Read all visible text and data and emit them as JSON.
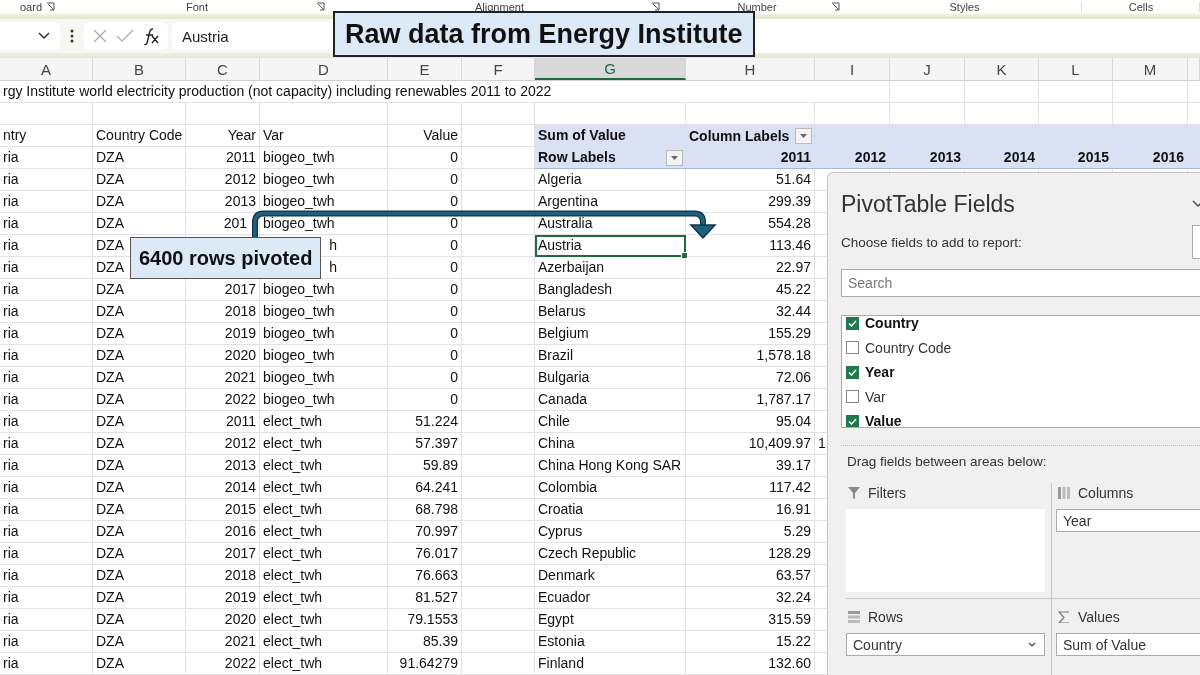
{
  "ribbon_groups": [
    {
      "label": "oard",
      "launcher": true
    },
    {
      "label": "Font",
      "launcher": true
    },
    {
      "label": "Alignment",
      "launcher": true
    },
    {
      "label": "Number",
      "launcher": true
    },
    {
      "label": "Styles",
      "launcher": false
    },
    {
      "label": "Cells",
      "launcher": false
    }
  ],
  "formula_bar": {
    "value": "Austria"
  },
  "callouts": [
    {
      "text": "Raw data from Energy Institute",
      "kind": "title"
    },
    {
      "text": "6400 rows pivoted",
      "kind": "note"
    }
  ],
  "columns": [
    {
      "label": "A",
      "selected": false
    },
    {
      "label": "B",
      "selected": false
    },
    {
      "label": "C",
      "selected": false
    },
    {
      "label": "D",
      "selected": false
    },
    {
      "label": "E",
      "selected": false
    },
    {
      "label": "F",
      "selected": false
    },
    {
      "label": "G",
      "selected": true
    },
    {
      "label": "H",
      "selected": false
    },
    {
      "label": "I",
      "selected": false
    },
    {
      "label": "J",
      "selected": false
    },
    {
      "label": "K",
      "selected": false
    },
    {
      "label": "L",
      "selected": false
    },
    {
      "label": "M",
      "selected": false
    }
  ],
  "sheet_title": "rgy Institute world electricity production (not capacity) including renewables 2011 to 2022",
  "raw_data": {
    "columns": [
      {
        "label": "ntry",
        "kind": "text"
      },
      {
        "label": "Country Code",
        "kind": "text"
      },
      {
        "label": "Year",
        "kind": "number"
      },
      {
        "label": "Var",
        "kind": "text"
      },
      {
        "label": "Value",
        "kind": "number"
      }
    ],
    "rows": [
      [
        "ria",
        "DZA",
        "2011",
        "biogeo_twh",
        "0"
      ],
      [
        "ria",
        "DZA",
        "2012",
        "biogeo_twh",
        "0"
      ],
      [
        "ria",
        "DZA",
        "2013",
        "biogeo_twh",
        "0"
      ],
      [
        "ria",
        "DZA",
        {
          "text": "201",
          "covered": true
        },
        "biogeo_twh",
        "0"
      ],
      [
        "ria",
        "DZA",
        null,
        {
          "text": "h",
          "covered": true
        },
        "0"
      ],
      [
        "ria",
        "DZA",
        null,
        {
          "text": "h",
          "covered": true
        },
        "0"
      ],
      [
        "ria",
        "DZA",
        "2017",
        "biogeo_twh",
        "0"
      ],
      [
        "ria",
        "DZA",
        "2018",
        "biogeo_twh",
        "0"
      ],
      [
        "ria",
        "DZA",
        "2019",
        "biogeo_twh",
        "0"
      ],
      [
        "ria",
        "DZA",
        "2020",
        "biogeo_twh",
        "0"
      ],
      [
        "ria",
        "DZA",
        "2021",
        "biogeo_twh",
        "0"
      ],
      [
        "ria",
        "DZA",
        "2022",
        "biogeo_twh",
        "0"
      ],
      [
        "ria",
        "DZA",
        "2011",
        "elect_twh",
        "51.224"
      ],
      [
        "ria",
        "DZA",
        "2012",
        "elect_twh",
        "57.397"
      ],
      [
        "ria",
        "DZA",
        "2013",
        "elect_twh",
        "59.89"
      ],
      [
        "ria",
        "DZA",
        "2014",
        "elect_twh",
        "64.241"
      ],
      [
        "ria",
        "DZA",
        "2015",
        "elect_twh",
        "68.798"
      ],
      [
        "ria",
        "DZA",
        "2016",
        "elect_twh",
        "70.997"
      ],
      [
        "ria",
        "DZA",
        "2017",
        "elect_twh",
        "76.017"
      ],
      [
        "ria",
        "DZA",
        "2018",
        "elect_twh",
        "76.663"
      ],
      [
        "ria",
        "DZA",
        "2019",
        "elect_twh",
        "81.527"
      ],
      [
        "ria",
        "DZA",
        "2020",
        "elect_twh",
        "79.1553"
      ],
      [
        "ria",
        "DZA",
        "2021",
        "elect_twh",
        "85.39"
      ],
      [
        "ria",
        "DZA",
        "2022",
        "elect_twh",
        "91.64279"
      ]
    ]
  },
  "pivot": {
    "value_label": "Sum of Value",
    "column_labels": "Column Labels",
    "row_labels": "Row Labels",
    "years": [
      "2011",
      "2012",
      "2013",
      "2014",
      "2015",
      "2016"
    ],
    "rows": [
      {
        "country": "Algeria",
        "values": [
          "51.64"
        ],
        "selected": false
      },
      {
        "country": "Argentina",
        "values": [
          "299.39"
        ],
        "selected": false
      },
      {
        "country": "Australia",
        "values": [
          "554.28"
        ],
        "selected": false
      },
      {
        "country": "Austria",
        "values": [
          "113.46"
        ],
        "selected": true
      },
      {
        "country": "Azerbaijan",
        "values": [
          "22.97"
        ],
        "selected": false
      },
      {
        "country": "Bangladesh",
        "values": [
          "45.22"
        ],
        "selected": false
      },
      {
        "country": "Belarus",
        "values": [
          "32.44"
        ],
        "selected": false
      },
      {
        "country": "Belgium",
        "values": [
          "155.29"
        ],
        "selected": false
      },
      {
        "country": "Brazil",
        "values": [
          "1,578.18"
        ],
        "selected": false
      },
      {
        "country": "Bulgaria",
        "values": [
          "72.06"
        ],
        "selected": false
      },
      {
        "country": "Canada",
        "values": [
          "1,787.17"
        ],
        "selected": false
      },
      {
        "country": "Chile",
        "values": [
          "95.04"
        ],
        "selected": false
      },
      {
        "country": "China",
        "values": [
          "10,409.97",
          "1"
        ],
        "selected": false
      },
      {
        "country": "China Hong Kong SAR",
        "values": [
          "39.17"
        ],
        "selected": false
      },
      {
        "country": "Colombia",
        "values": [
          "117.42"
        ],
        "selected": false
      },
      {
        "country": "Croatia",
        "values": [
          "16.91"
        ],
        "selected": false
      },
      {
        "country": "Cyprus",
        "values": [
          "5.29"
        ],
        "selected": false
      },
      {
        "country": "Czech Republic",
        "values": [
          "128.29"
        ],
        "selected": false
      },
      {
        "country": "Denmark",
        "values": [
          "63.57"
        ],
        "selected": false
      },
      {
        "country": "Ecuador",
        "values": [
          "32.24"
        ],
        "selected": false
      },
      {
        "country": "Egypt",
        "values": [
          "315.59"
        ],
        "selected": false
      },
      {
        "country": "Estonia",
        "values": [
          "15.22"
        ],
        "selected": false
      },
      {
        "country": "Finland",
        "values": [
          "132.60"
        ],
        "selected": false
      }
    ]
  },
  "pivot_panel": {
    "title": "PivotTable Fields",
    "prompt": "Choose fields to add to report:",
    "search": {
      "placeholder": "Search"
    },
    "fields": [
      {
        "label": "Country",
        "checked": true
      },
      {
        "label": "Country Code",
        "checked": false
      },
      {
        "label": "Year",
        "checked": true
      },
      {
        "label": "Var",
        "checked": false
      },
      {
        "label": "Value",
        "checked": true
      }
    ],
    "areas_prompt": "Drag fields between areas below:",
    "areas": [
      {
        "kind": "filters",
        "label": "Filters"
      },
      {
        "kind": "columns",
        "label": "Columns",
        "items": [
          {
            "label": "Year",
            "dropdown": false
          }
        ]
      },
      {
        "kind": "rows",
        "label": "Rows",
        "items": [
          {
            "label": "Country",
            "dropdown": true
          }
        ]
      },
      {
        "kind": "values",
        "label": "Values",
        "items": [
          {
            "label": "Sum of Value",
            "dropdown": false
          }
        ]
      }
    ]
  }
}
